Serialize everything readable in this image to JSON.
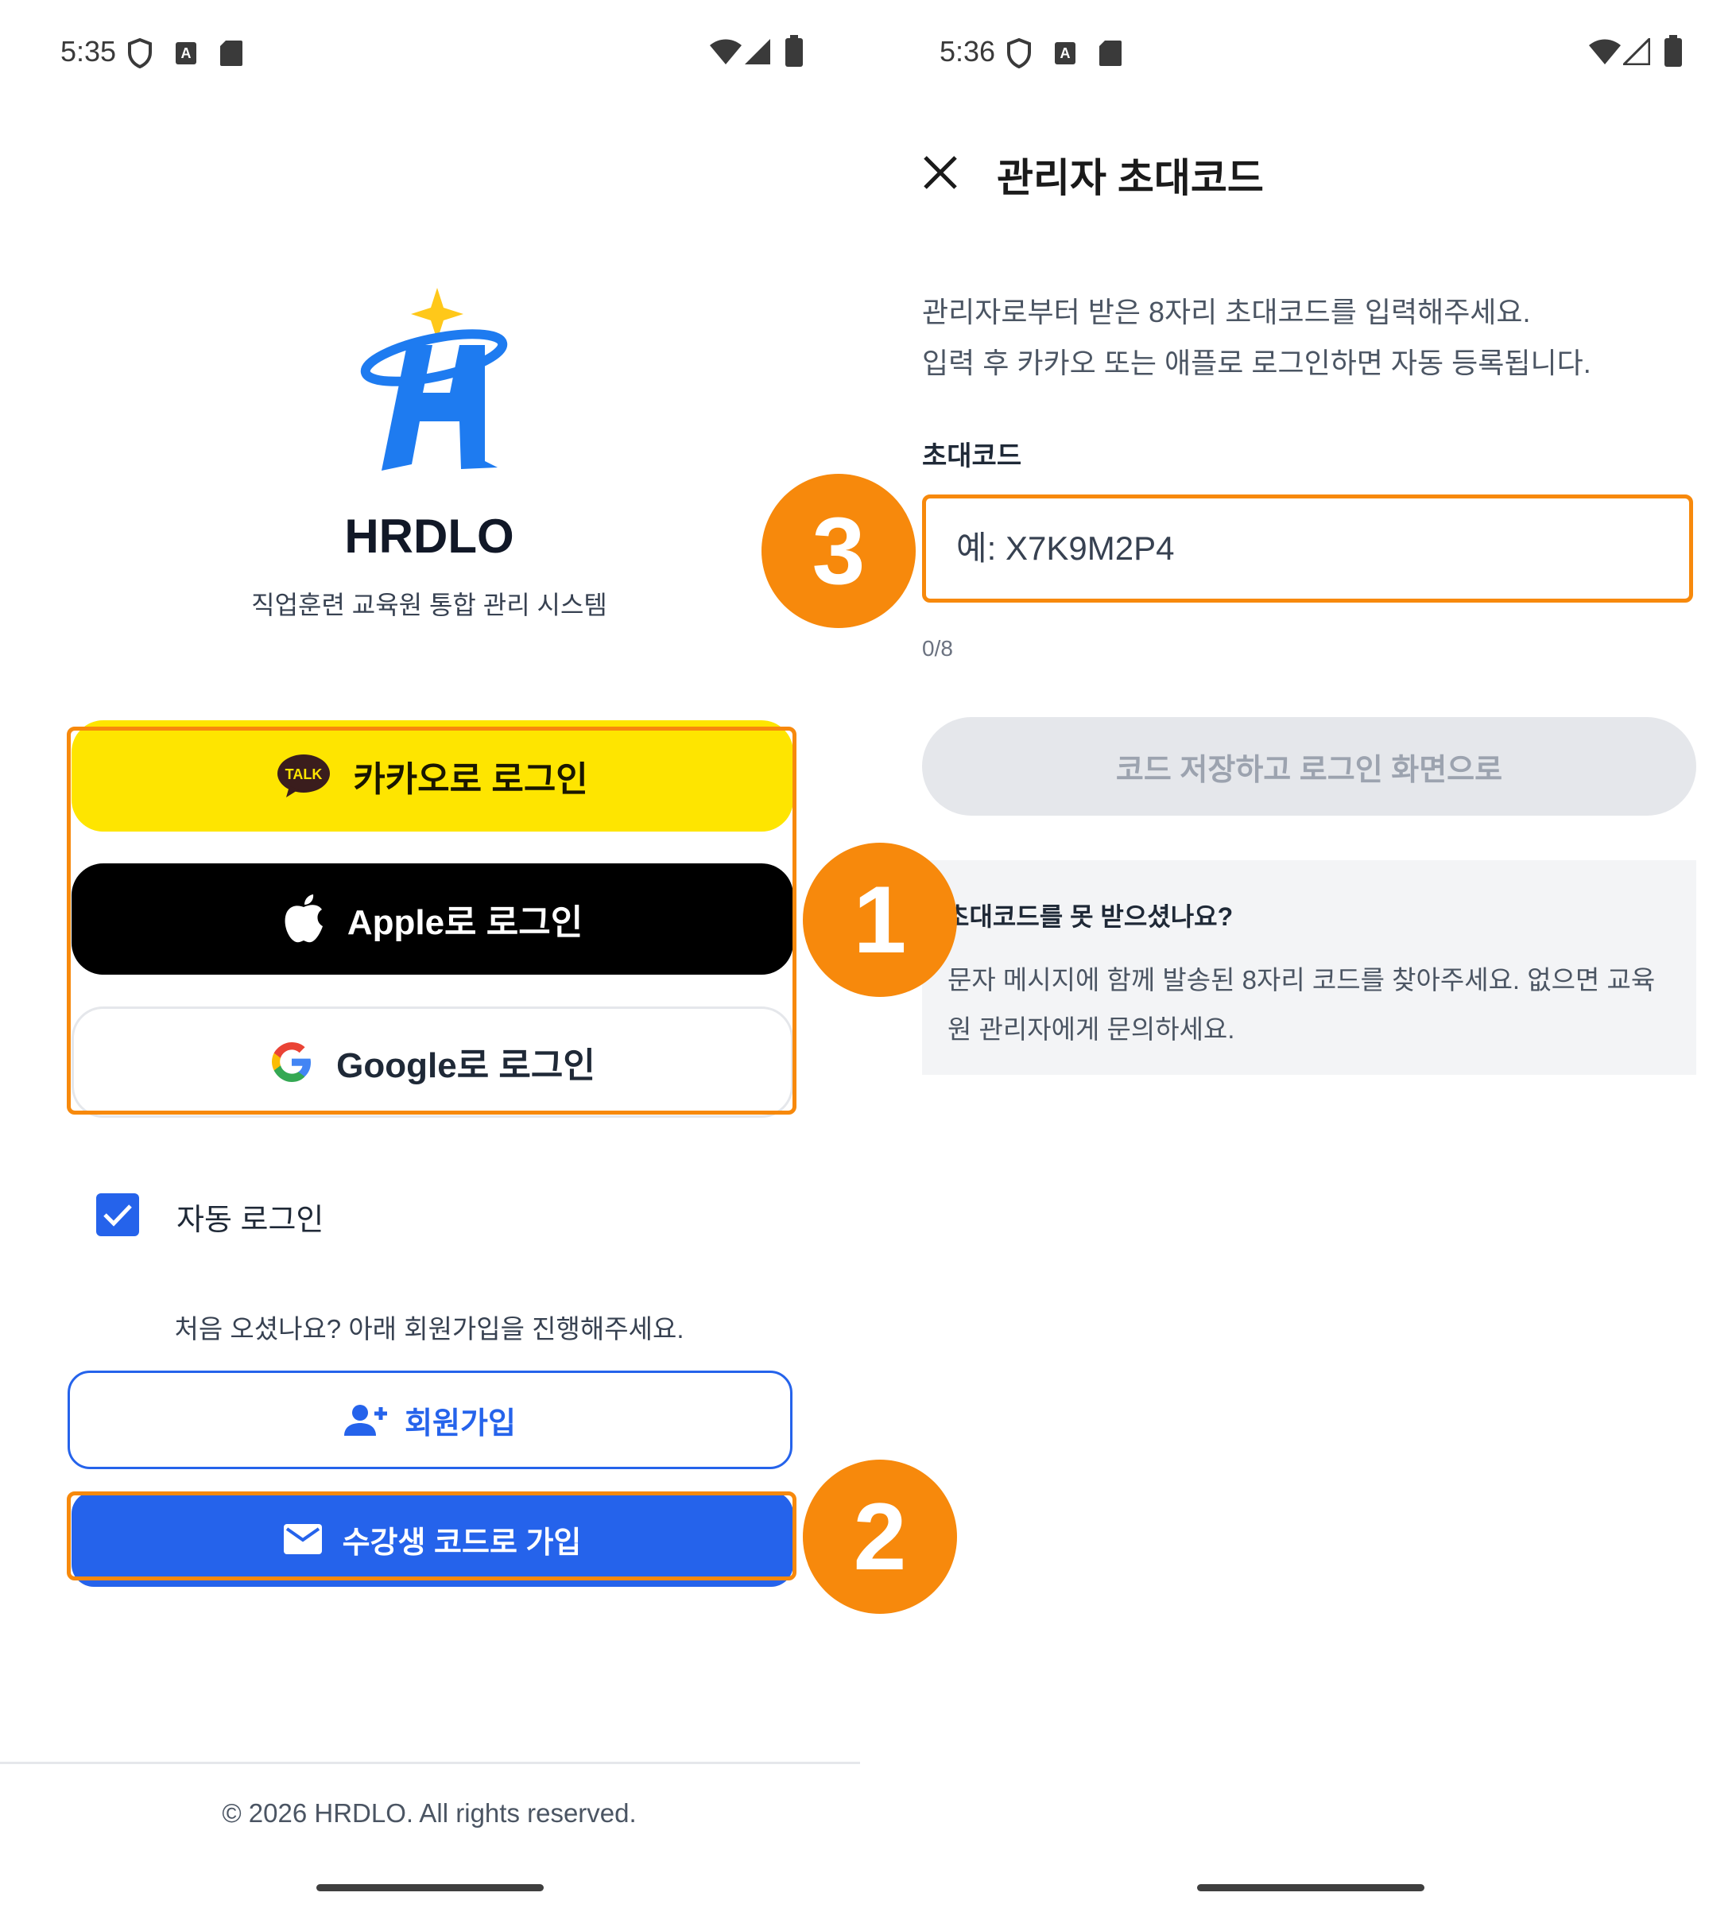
{
  "left_screen": {
    "status_time": "5:35",
    "brand_title": "HRDLO",
    "brand_subtitle": "직업훈련 교육원 통합 관리 시스템",
    "kakao_label": "카카오로 로그인",
    "kakao_icon_text": "TALK",
    "apple_label": "Apple로 로그인",
    "google_label": "Google로 로그인",
    "auto_login_label": "자동 로그인",
    "auto_login_checked": true,
    "first_visit_text": "처음 오셨나요? 아래 회원가입을 진행해주세요.",
    "signup_label": "회원가입",
    "student_code_label": "수강생 코드로 가입",
    "copyright": "© 2026 HRDLO. All rights reserved."
  },
  "right_screen": {
    "status_time": "5:36",
    "title": "관리자 초대코드",
    "description_line1": "관리자로부터 받은 8자리 초대코드를 입력해주세요.",
    "description_line2": "입력 후 카카오 또는 애플로 로그인하면 자동 등록됩니다.",
    "field_label": "초대코드",
    "code_placeholder": "예: X7K9M2P4",
    "code_value": "",
    "char_counter": "0/8",
    "save_button_label": "코드 저장하고 로그인 화면으로",
    "help_title": "초대코드를 못 받으셨나요?",
    "help_text_line1": "문자 메시지에 함께 발송된 8자리 코드를 찾아주세요. 없으면 교육",
    "help_text_line2": "원 관리자에게 문의하세요."
  },
  "badges": {
    "one": "1",
    "two": "2",
    "three": "3"
  },
  "colors": {
    "accent_blue": "#2563eb",
    "kakao_yellow": "#FEE500",
    "highlight_orange": "#F7890C",
    "disabled_gray": "#e5e7eb"
  }
}
